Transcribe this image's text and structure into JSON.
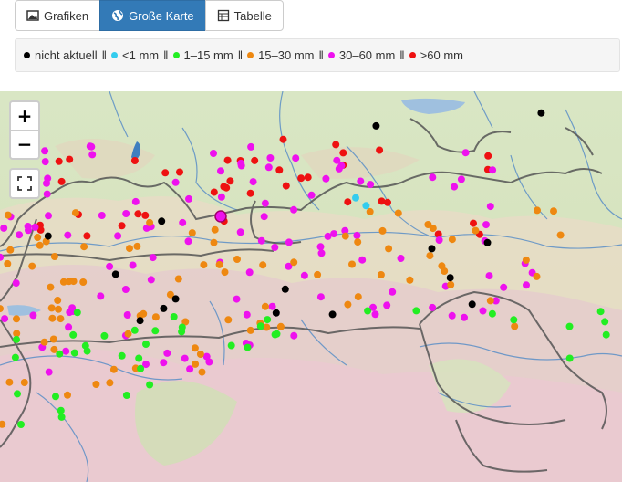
{
  "tabs": [
    {
      "label": "Grafiken",
      "icon": "image-icon",
      "active": false
    },
    {
      "label": "Große Karte",
      "icon": "globe-icon",
      "active": true
    },
    {
      "label": "Tabelle",
      "icon": "table-icon",
      "active": false
    }
  ],
  "legend": [
    {
      "label": "nicht aktuell",
      "color": "#000000"
    },
    {
      "label": "<1 mm",
      "color": "#33ccee"
    },
    {
      "label": "1–15 mm",
      "color": "#22ee22"
    },
    {
      "label": "15–30 mm",
      "color": "#ee8811"
    },
    {
      "label": "30–60 mm",
      "color": "#ee11ee"
    },
    {
      "label": ">60 mm",
      "color": "#ee1111"
    }
  ],
  "legend_separator": "‖",
  "map_controls": {
    "zoom_in": "+",
    "zoom_out": "−"
  },
  "colors": {
    "black": "#000000",
    "cyan": "#33ccee",
    "green": "#22ee22",
    "orange": "#ee8811",
    "magenta": "#ee11ee",
    "red": "#ee1111"
  },
  "station_counts": {
    "black": 15,
    "cyan": 2,
    "green": 40,
    "orange": 90,
    "magenta": 120,
    "red": 40
  }
}
